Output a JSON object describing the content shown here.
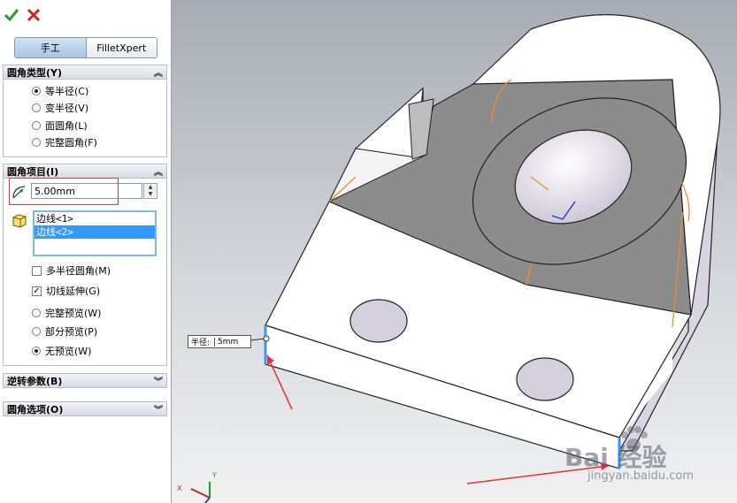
{
  "toolbar": {
    "ok_icon": "check-icon",
    "cancel_icon": "cross-icon"
  },
  "tabs": [
    {
      "label": "手工"
    },
    {
      "label": "FilletXpert"
    }
  ],
  "fillet_type": {
    "title": "圆角类型(Y)",
    "options": [
      {
        "label": "等半径(C)",
        "selected": true
      },
      {
        "label": "变半径(V)",
        "selected": false
      },
      {
        "label": "面圆角(L)",
        "selected": false
      },
      {
        "label": "完整圆角(F)",
        "selected": false
      }
    ]
  },
  "fillet_items": {
    "title": "圆角项目(I)",
    "radius_value": "5.00mm",
    "edges": [
      "边线<1>",
      "边线<2>"
    ],
    "options": [
      {
        "label": "多半径圆角(M)",
        "type": "checkbox",
        "checked": false
      },
      {
        "label": "切线延伸(G)",
        "type": "checkbox",
        "checked": true
      },
      {
        "label": "完整预览(W)",
        "type": "radio",
        "checked": false
      },
      {
        "label": "部分预览(P)",
        "type": "radio",
        "checked": false
      },
      {
        "label": "无预览(W)",
        "type": "radio",
        "checked": true
      }
    ]
  },
  "reverse_params": {
    "title": "逆转参数(B)"
  },
  "fillet_options": {
    "title": "圆角选项(O)"
  },
  "callout": {
    "label": "半径:",
    "value": "5mm"
  },
  "triad": {
    "x": "X",
    "y": "Y"
  },
  "watermark": {
    "logo": "Bai 经验",
    "url": "jingyan.baidu.com"
  },
  "colors": {
    "accent": "#3399ff",
    "annotation": "#e33333",
    "edge_highlight": "#f08a2c"
  }
}
